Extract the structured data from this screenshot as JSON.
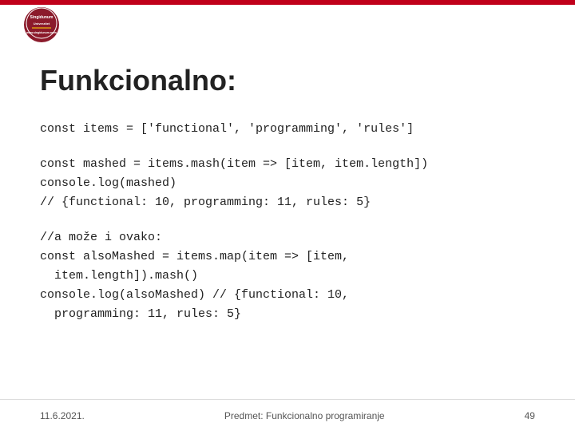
{
  "topbar": {
    "color": "#c0001a"
  },
  "logo": {
    "line1": "Singidunum",
    "line2": "Univerzitet"
  },
  "slide": {
    "title": "Funkcionalno:",
    "code_sections": [
      {
        "id": "section1",
        "lines": [
          "const items = ['functional', 'programming', 'rules']"
        ]
      },
      {
        "id": "section2",
        "lines": [
          "const mashed = items.mash(item => [item, item.length])",
          "console.log(mashed)",
          "// {functional: 10, programming: 11, rules: 5}"
        ]
      },
      {
        "id": "section3",
        "lines": [
          "//a može i ovako:",
          "const alsoMashed = items.map(item => [item,",
          "  item.length]).mash()",
          "console.log(alsoMashed) // {functional: 10,",
          "  programming: 11, rules: 5}"
        ]
      }
    ]
  },
  "footer": {
    "date": "11.6.2021.",
    "subject": "Predmet: Funkcionalno programiranje",
    "page": "49"
  }
}
